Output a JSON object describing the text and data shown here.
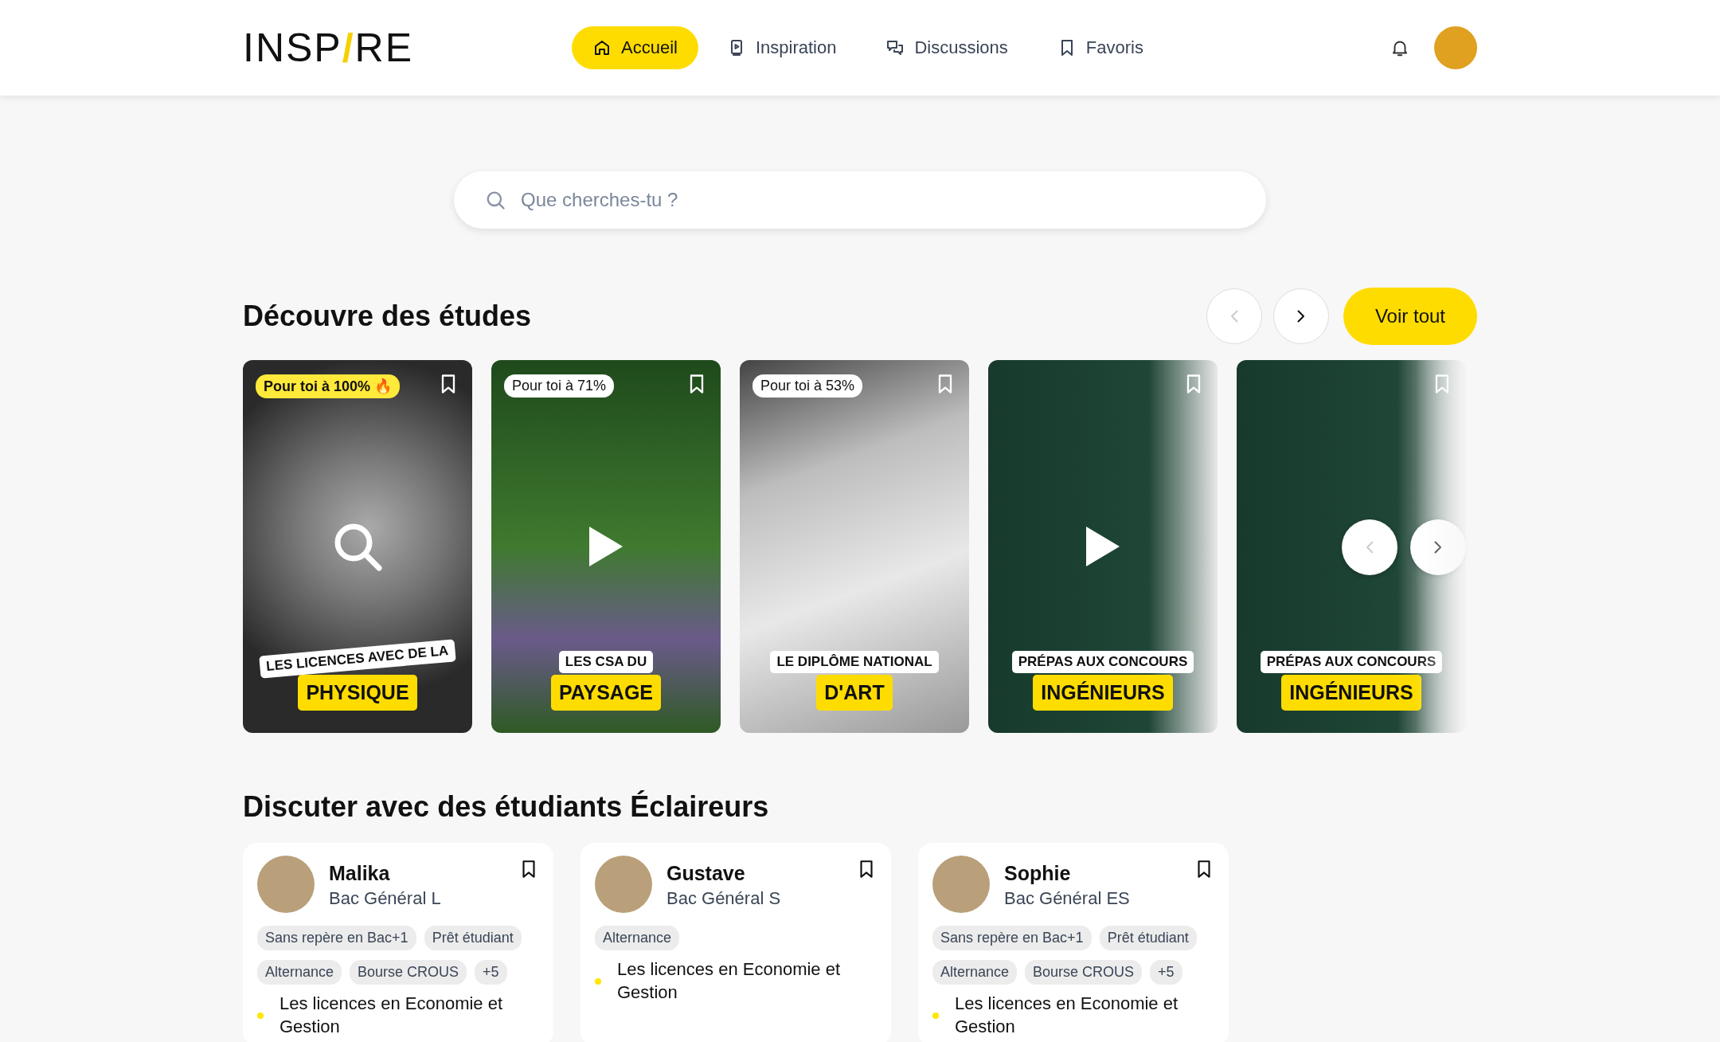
{
  "header": {
    "logo": "INSP**/**RE",
    "nav": [
      {
        "label": "Accueil",
        "selected": true
      },
      {
        "label": "Inspiration",
        "selected": false
      },
      {
        "label": "Discussions",
        "selected": false
      },
      {
        "label": "Favoris",
        "selected": false
      }
    ]
  },
  "search": {
    "placeholder": "Que cherches-tu ?"
  },
  "studies": {
    "title": "Découvre des études",
    "prev_disabled": true,
    "see_all": "Voir tout",
    "cards": [
      {
        "badge": "Pour toi à 100% 🔥",
        "highlight": true,
        "kind": "search",
        "caption_top": "LES LICENCES AVEC DE LA",
        "caption_main": "PHYSIQUE",
        "tilted": true
      },
      {
        "badge": "Pour toi à 71%",
        "highlight": false,
        "kind": "play",
        "caption_top": "LES CSA DU",
        "caption_main": "PAYSAGE",
        "tilted": false
      },
      {
        "badge": "Pour toi à 53%",
        "highlight": false,
        "kind": "plain",
        "caption_top": "LE DIPLÔME NATIONAL",
        "caption_main": "D'ART",
        "tilted": false
      },
      {
        "kind": "play",
        "caption_top": "PRÉPAS AUX CONCOURS",
        "caption_main": "INGÉNIEURS",
        "tilted": false
      },
      {
        "kind": "plain",
        "caption_top": "PRÉPAS AUX CONCOURS",
        "caption_main": "INGÉNIEURS",
        "tilted": false
      }
    ],
    "overlay_prev_disabled": true
  },
  "students": {
    "title": "Discuter avec des étudiants Éclaireurs",
    "cards": [
      {
        "name": "Malika",
        "track": "Bac Général L",
        "tags": [
          "Sans repère en Bac+1",
          "Prêt étudiant",
          "Alternance",
          "Bourse CROUS",
          "+5"
        ],
        "topic": "Les licences en Economie et Gestion"
      },
      {
        "name": "Gustave",
        "track": "Bac Général S",
        "tags": [
          "Alternance"
        ],
        "topic": "Les licences en Economie et Gestion"
      },
      {
        "name": "Sophie",
        "track": "Bac Général ES",
        "tags": [
          "Sans repère en Bac+1",
          "Prêt étudiant",
          "Alternance",
          "Bourse CROUS",
          "+5"
        ],
        "topic": "Les licences en Economie et Gestion"
      }
    ]
  }
}
